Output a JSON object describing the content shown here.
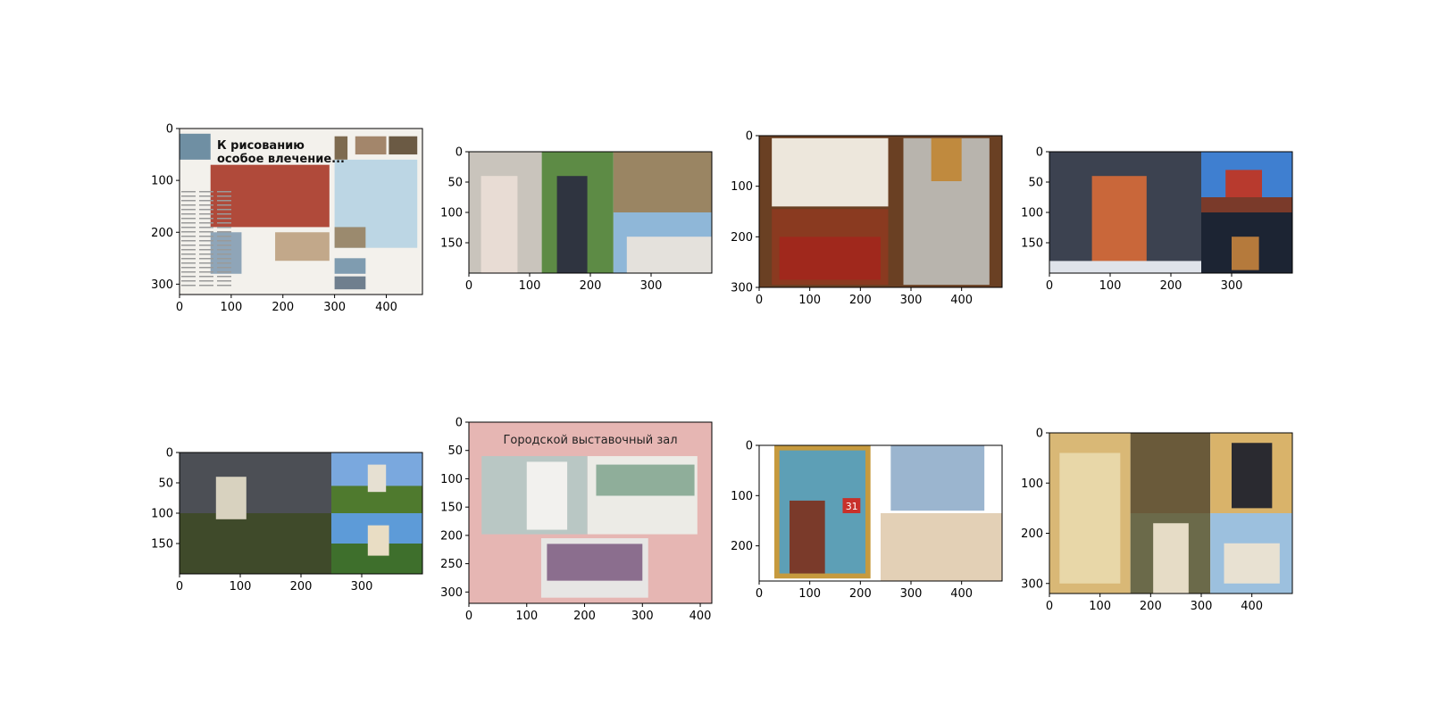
{
  "figure": {
    "rows": 2,
    "cols": 4
  },
  "chart_data": [
    {
      "type": "image",
      "xlim": [
        0,
        470
      ],
      "ylim": [
        320,
        0
      ],
      "xticks": [
        0,
        100,
        200,
        300,
        400
      ],
      "yticks": [
        0,
        100,
        200,
        300
      ],
      "content": "newspaper-spread",
      "text": [
        "К рисованию",
        "особое влечение..."
      ],
      "panels": [
        {
          "x0": 0,
          "y0": 0,
          "x1": 470,
          "y1": 320,
          "fill": "#f3f1ec",
          "kind": "paper"
        },
        {
          "x0": 60,
          "y0": 70,
          "x1": 290,
          "y1": 190,
          "fill": "#b04a3a",
          "kind": "photo"
        },
        {
          "x0": 60,
          "y0": 200,
          "x1": 120,
          "y1": 280,
          "fill": "#8fa5b8",
          "kind": "photo"
        },
        {
          "x0": 185,
          "y0": 200,
          "x1": 290,
          "y1": 255,
          "fill": "#c2a88a",
          "kind": "photo"
        },
        {
          "x0": 300,
          "y0": 15,
          "x1": 325,
          "y1": 60,
          "fill": "#7d6a4f",
          "kind": "photo"
        },
        {
          "x0": 340,
          "y0": 15,
          "x1": 400,
          "y1": 50,
          "fill": "#a3866b",
          "kind": "photo"
        },
        {
          "x0": 405,
          "y0": 15,
          "x1": 460,
          "y1": 50,
          "fill": "#6b5a44",
          "kind": "photo"
        },
        {
          "x0": 300,
          "y0": 60,
          "x1": 460,
          "y1": 230,
          "fill": "#bcd6e4",
          "kind": "text-box"
        },
        {
          "x0": 300,
          "y0": 190,
          "x1": 360,
          "y1": 230,
          "fill": "#9b8a6e",
          "kind": "photo"
        },
        {
          "x0": 300,
          "y0": 250,
          "x1": 360,
          "y1": 280,
          "fill": "#7f9cb0",
          "kind": "photo"
        },
        {
          "x0": 300,
          "y0": 285,
          "x1": 360,
          "y1": 310,
          "fill": "#6f7f8e",
          "kind": "photo"
        },
        {
          "x0": 0,
          "y0": 10,
          "x1": 60,
          "y1": 60,
          "fill": "#6f8fa3",
          "kind": "photo"
        }
      ]
    },
    {
      "type": "image",
      "xlim": [
        0,
        400
      ],
      "ylim": [
        200,
        0
      ],
      "xticks": [
        0,
        100,
        200,
        300
      ],
      "yticks": [
        0,
        50,
        100,
        150
      ],
      "content": "wedding-collage",
      "text": [],
      "panels": [
        {
          "x0": 0,
          "y0": 0,
          "x1": 120,
          "y1": 200,
          "fill": "#c9c4bc",
          "kind": "photo"
        },
        {
          "x0": 120,
          "y0": 0,
          "x1": 238,
          "y1": 200,
          "fill": "#5d8b45",
          "kind": "photo"
        },
        {
          "x0": 238,
          "y0": 0,
          "x1": 400,
          "y1": 100,
          "fill": "#9a8563",
          "kind": "photo"
        },
        {
          "x0": 238,
          "y0": 100,
          "x1": 400,
          "y1": 200,
          "fill": "#8fb7d8",
          "kind": "photo"
        },
        {
          "x0": 20,
          "y0": 40,
          "x1": 80,
          "y1": 200,
          "fill": "#e8dcd4",
          "kind": "photo"
        },
        {
          "x0": 145,
          "y0": 40,
          "x1": 195,
          "y1": 200,
          "fill": "#2f3440",
          "kind": "photo"
        },
        {
          "x0": 260,
          "y0": 140,
          "x1": 400,
          "y1": 200,
          "fill": "#e4e1dc",
          "kind": "photo"
        }
      ]
    },
    {
      "type": "image",
      "xlim": [
        0,
        480
      ],
      "ylim": [
        300,
        0
      ],
      "xticks": [
        0,
        100,
        200,
        300,
        400
      ],
      "yticks": [
        0,
        100,
        200,
        300
      ],
      "content": "interior-collage",
      "text": [],
      "panels": [
        {
          "x0": 0,
          "y0": 0,
          "x1": 480,
          "y1": 300,
          "fill": "#6a4023",
          "kind": "frame"
        },
        {
          "x0": 25,
          "y0": 5,
          "x1": 255,
          "y1": 140,
          "fill": "#ede7dc",
          "kind": "photo"
        },
        {
          "x0": 25,
          "y0": 145,
          "x1": 255,
          "y1": 295,
          "fill": "#8a3a20",
          "kind": "photo"
        },
        {
          "x0": 285,
          "y0": 5,
          "x1": 455,
          "y1": 295,
          "fill": "#b8b4ad",
          "kind": "photo"
        },
        {
          "x0": 40,
          "y0": 200,
          "x1": 240,
          "y1": 285,
          "fill": "#a0281c",
          "kind": "photo"
        },
        {
          "x0": 340,
          "y0": 5,
          "x1": 400,
          "y1": 90,
          "fill": "#c08a3e",
          "kind": "photo"
        }
      ]
    },
    {
      "type": "image",
      "xlim": [
        0,
        400
      ],
      "ylim": [
        200,
        0
      ],
      "xticks": [
        0,
        100,
        200,
        300
      ],
      "yticks": [
        0,
        50,
        100,
        150
      ],
      "content": "tower-collage",
      "text": [],
      "panels": [
        {
          "x0": 0,
          "y0": 0,
          "x1": 250,
          "y1": 200,
          "fill": "#3c4250",
          "kind": "photo"
        },
        {
          "x0": 250,
          "y0": 0,
          "x1": 400,
          "y1": 100,
          "fill": "#3f7fd0",
          "kind": "photo"
        },
        {
          "x0": 250,
          "y0": 100,
          "x1": 400,
          "y1": 200,
          "fill": "#1c2433",
          "kind": "photo"
        },
        {
          "x0": 70,
          "y0": 40,
          "x1": 160,
          "y1": 195,
          "fill": "#c9673a",
          "kind": "photo"
        },
        {
          "x0": 290,
          "y0": 30,
          "x1": 350,
          "y1": 85,
          "fill": "#b83a2e",
          "kind": "photo"
        },
        {
          "x0": 300,
          "y0": 140,
          "x1": 345,
          "y1": 195,
          "fill": "#b57a3c",
          "kind": "photo"
        },
        {
          "x0": 0,
          "y0": 180,
          "x1": 250,
          "y1": 200,
          "fill": "#dfe3ea",
          "kind": "photo"
        },
        {
          "x0": 250,
          "y0": 75,
          "x1": 400,
          "y1": 100,
          "fill": "#7a3a2a",
          "kind": "photo"
        }
      ]
    },
    {
      "type": "image",
      "xlim": [
        0,
        400
      ],
      "ylim": [
        200,
        0
      ],
      "xticks": [
        0,
        100,
        200,
        300
      ],
      "yticks": [
        0,
        50,
        100,
        150
      ],
      "content": "church-collage",
      "text": [],
      "panels": [
        {
          "x0": 0,
          "y0": 0,
          "x1": 250,
          "y1": 200,
          "fill": "#4c4f55",
          "kind": "photo"
        },
        {
          "x0": 0,
          "y0": 100,
          "x1": 250,
          "y1": 200,
          "fill": "#3f4a2a",
          "kind": "photo"
        },
        {
          "x0": 250,
          "y0": 0,
          "x1": 400,
          "y1": 100,
          "fill": "#7aa8de",
          "kind": "photo"
        },
        {
          "x0": 250,
          "y0": 100,
          "x1": 400,
          "y1": 200,
          "fill": "#5d9bd8",
          "kind": "photo"
        },
        {
          "x0": 250,
          "y0": 55,
          "x1": 400,
          "y1": 100,
          "fill": "#4f7a2e",
          "kind": "photo"
        },
        {
          "x0": 250,
          "y0": 150,
          "x1": 400,
          "y1": 200,
          "fill": "#3e6f2c",
          "kind": "photo"
        },
        {
          "x0": 60,
          "y0": 40,
          "x1": 110,
          "y1": 110,
          "fill": "#d8d2bf",
          "kind": "photo"
        },
        {
          "x0": 310,
          "y0": 20,
          "x1": 340,
          "y1": 65,
          "fill": "#e6e0d2",
          "kind": "photo"
        },
        {
          "x0": 310,
          "y0": 120,
          "x1": 345,
          "y1": 170,
          "fill": "#e9ddc4",
          "kind": "photo"
        }
      ]
    },
    {
      "type": "image",
      "xlim": [
        0,
        420
      ],
      "ylim": [
        320,
        0
      ],
      "xticks": [
        0,
        100,
        200,
        300,
        400
      ],
      "yticks": [
        0,
        50,
        100,
        150,
        200,
        250,
        300
      ],
      "content": "exhibition-hall",
      "text": [
        "Городской выставочный зал"
      ],
      "panels": [
        {
          "x0": 0,
          "y0": 0,
          "x1": 420,
          "y1": 320,
          "fill": "#e6b6b3",
          "kind": "background"
        },
        {
          "x0": 22,
          "y0": 60,
          "x1": 205,
          "y1": 198,
          "fill": "#b9c7c4",
          "kind": "photo"
        },
        {
          "x0": 205,
          "y0": 60,
          "x1": 395,
          "y1": 198,
          "fill": "#ecebe6",
          "kind": "photo"
        },
        {
          "x0": 125,
          "y0": 205,
          "x1": 310,
          "y1": 310,
          "fill": "#e7e6e4",
          "kind": "photo"
        },
        {
          "x0": 100,
          "y0": 70,
          "x1": 170,
          "y1": 190,
          "fill": "#f2f1ee",
          "kind": "photo"
        },
        {
          "x0": 220,
          "y0": 75,
          "x1": 390,
          "y1": 130,
          "fill": "#8fae9a",
          "kind": "photo"
        },
        {
          "x0": 135,
          "y0": 215,
          "x1": 300,
          "y1": 280,
          "fill": "#8b6e8e",
          "kind": "photo"
        }
      ]
    },
    {
      "type": "image",
      "xlim": [
        0,
        480
      ],
      "ylim": [
        270,
        0
      ],
      "xticks": [
        0,
        100,
        200,
        300,
        400
      ],
      "yticks": [
        0,
        100,
        200
      ],
      "content": "calendar-collage",
      "text": [
        "31"
      ],
      "panels": [
        {
          "x0": 30,
          "y0": 0,
          "x1": 220,
          "y1": 265,
          "fill": "#c69a3e",
          "kind": "icon"
        },
        {
          "x0": 40,
          "y0": 10,
          "x1": 210,
          "y1": 255,
          "fill": "#5d9fb6",
          "kind": "icon"
        },
        {
          "x0": 260,
          "y0": 0,
          "x1": 445,
          "y1": 130,
          "fill": "#9bb5cf",
          "kind": "card"
        },
        {
          "x0": 240,
          "y0": 135,
          "x1": 480,
          "y1": 270,
          "fill": "#e3d0b6",
          "kind": "card"
        },
        {
          "x0": 60,
          "y0": 110,
          "x1": 130,
          "y1": 255,
          "fill": "#7a3a2a",
          "kind": "icon"
        },
        {
          "x0": 165,
          "y0": 105,
          "x1": 200,
          "y1": 135,
          "fill": "#c8302a",
          "kind": "badge"
        }
      ]
    },
    {
      "type": "image",
      "xlim": [
        0,
        480
      ],
      "ylim": [
        320,
        0
      ],
      "xticks": [
        0,
        100,
        200,
        300,
        400
      ],
      "yticks": [
        0,
        100,
        200,
        300
      ],
      "content": "saint-collage",
      "text": [],
      "panels": [
        {
          "x0": 0,
          "y0": 0,
          "x1": 160,
          "y1": 320,
          "fill": "#d9b876",
          "kind": "photo"
        },
        {
          "x0": 160,
          "y0": 0,
          "x1": 318,
          "y1": 160,
          "fill": "#6a5a3a",
          "kind": "photo"
        },
        {
          "x0": 318,
          "y0": 0,
          "x1": 480,
          "y1": 160,
          "fill": "#d9b36a",
          "kind": "icon"
        },
        {
          "x0": 160,
          "y0": 160,
          "x1": 318,
          "y1": 320,
          "fill": "#6b6a4a",
          "kind": "photo"
        },
        {
          "x0": 318,
          "y0": 160,
          "x1": 480,
          "y1": 320,
          "fill": "#9cc0de",
          "kind": "photo"
        },
        {
          "x0": 20,
          "y0": 40,
          "x1": 140,
          "y1": 300,
          "fill": "#e8d7a8",
          "kind": "photo"
        },
        {
          "x0": 360,
          "y0": 20,
          "x1": 440,
          "y1": 150,
          "fill": "#2a2a30",
          "kind": "icon"
        },
        {
          "x0": 205,
          "y0": 180,
          "x1": 275,
          "y1": 320,
          "fill": "#e6dcc6",
          "kind": "photo"
        },
        {
          "x0": 345,
          "y0": 220,
          "x1": 455,
          "y1": 300,
          "fill": "#e8e1d2",
          "kind": "photo"
        }
      ]
    }
  ]
}
